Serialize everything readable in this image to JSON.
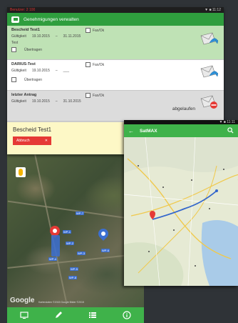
{
  "permit_app": {
    "statusbar_left": "Benutzer: 2 100",
    "statusbar_right": "▼ ■ 11:12",
    "header_title": "Genehmigungen verwalten",
    "permits": [
      {
        "title": "Bescheid Test1",
        "validity_label": "Gültigkeit",
        "from": "19.10.2015",
        "to": "31.11.2015",
        "status_line": "Test",
        "fax_label": "Fax/Ok",
        "checkbox_label": "Übertragen",
        "state": "active"
      },
      {
        "title": "DARIUS-Test",
        "validity_label": "Gültigkeit",
        "from": "19.10.2015",
        "to": "___",
        "fax_label": "Fax/Ok",
        "checkbox_label": "Übertragen",
        "state": "pending"
      },
      {
        "title": "letzter Antrag",
        "validity_label": "Gültigkeit",
        "from": "19.10.2015",
        "to": "31.10.2015",
        "fax_label": "Fax/Ok",
        "expired_label": "abgelaufen",
        "state": "expired"
      }
    ],
    "bescheid": {
      "title": "Bescheid Test1",
      "cancel_label": "Abbruch"
    }
  },
  "map_app": {
    "google_label": "Google",
    "attribution": "Kartendaten ©2015 Google Bilder ©2015",
    "waypoints": [
      "WP-1",
      "WP-2",
      "WP-3",
      "WP-4",
      "WP-5",
      "WP-6",
      "WP-7",
      "WP-8"
    ]
  },
  "road_app": {
    "statusbar": "▼ ■ 11:11",
    "title": "SatMAX",
    "back_icon": "arrow-left-icon",
    "search_icon": "search-icon"
  },
  "colors": {
    "green": "#3fb24a",
    "header_green": "#2f9e3e",
    "selected_card": "#bfe2b5",
    "expired_card": "#dcdcdc",
    "bescheid_bg": "#fdf8c6",
    "cancel_red": "#e53935",
    "route_blue": "#3366cc"
  }
}
